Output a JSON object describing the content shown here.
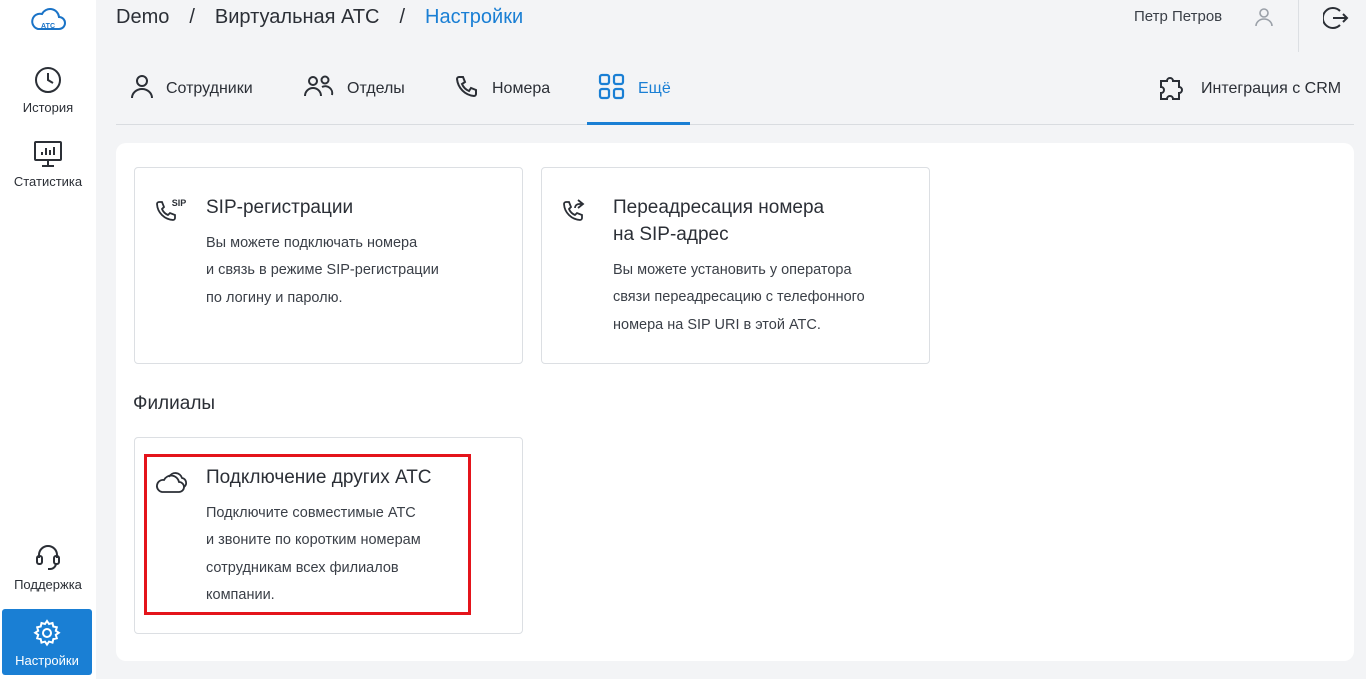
{
  "app": {
    "logo_text": "АТС"
  },
  "sidebar": {
    "items": [
      {
        "label": "История",
        "icon": "clock-icon"
      },
      {
        "label": "Статистика",
        "icon": "chart-monitor-icon"
      },
      {
        "label": "Поддержка",
        "icon": "headset-icon"
      },
      {
        "label": "Настройки",
        "icon": "gear-icon",
        "active": true
      }
    ]
  },
  "header": {
    "breadcrumb": [
      "Demo",
      "Виртуальная АТС",
      "Настройки"
    ],
    "separator": "/",
    "user_name": "Петр Петров"
  },
  "tabs": {
    "items": [
      {
        "label": "Сотрудники",
        "icon": "user-icon"
      },
      {
        "label": "Отделы",
        "icon": "users-icon"
      },
      {
        "label": "Номера",
        "icon": "phone-icon"
      },
      {
        "label": "Ещё",
        "icon": "grid-icon",
        "active": true
      }
    ],
    "crm": {
      "label": "Интеграция с CRM",
      "icon": "puzzle-icon"
    }
  },
  "cards": {
    "sip": {
      "title": "SIP-регистрации",
      "icon_text": "SIP",
      "desc": [
        "Вы можете подключать номера",
        "и связь в режиме SIP-регистрации",
        "по логину и паролю."
      ]
    },
    "forward": {
      "title": [
        "Переадресация номера",
        "на SIP-адрес"
      ],
      "desc": [
        "Вы можете установить у оператора",
        "связи переадресацию с телефонного",
        "номера на SIP URI в этой АТС."
      ]
    }
  },
  "branches": {
    "section_title": "Филиалы",
    "card": {
      "title": "Подключение других АТС",
      "desc": [
        "Подключите совместимые АТС",
        "и звоните по коротким номерам",
        "сотрудникам всех филиалов",
        "компании."
      ]
    }
  },
  "colors": {
    "accent": "#1a7fd4",
    "highlight": "#e4141b",
    "text": "#2b2f36"
  }
}
